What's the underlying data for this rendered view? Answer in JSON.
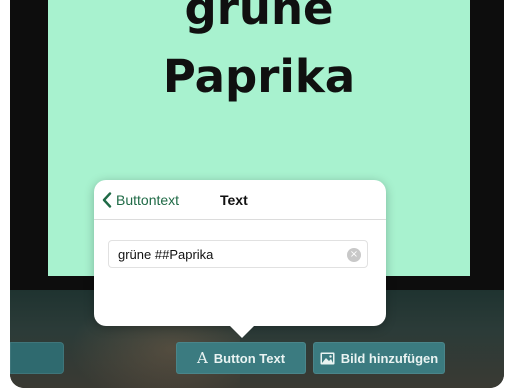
{
  "preview": {
    "line1": "grüne",
    "line2": "Paprika",
    "background": "#a8f2cf"
  },
  "popover": {
    "back_label": "Buttontext",
    "title": "Text",
    "field_value": "grüne ##Paprika",
    "clear_icon": "×"
  },
  "toolbar": {
    "text_button_glyph": "A",
    "text_button_label": "Button Text",
    "image_button_label": "Bild hinzufügen",
    "button_color": "#3b7b80"
  },
  "icons": {
    "back": "chevron-left-icon",
    "clear": "clear-circle-icon",
    "image": "image-icon"
  }
}
